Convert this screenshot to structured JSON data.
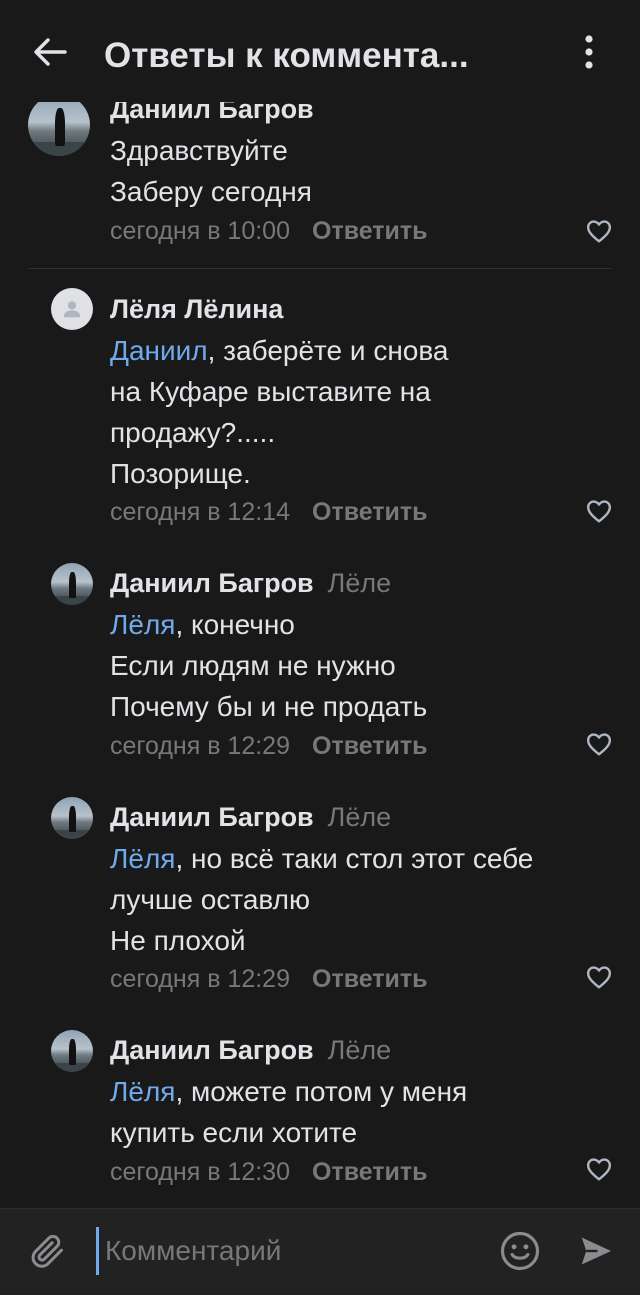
{
  "header": {
    "title": "Ответы к коммента...",
    "back_icon": "arrow-left-icon",
    "menu_icon": "more-vertical-icon"
  },
  "comments": [
    {
      "author": "Даниил Багров",
      "reply_to": "",
      "avatar": "photo",
      "lines": [
        "Здравствуйте",
        "Заберу сегодня"
      ],
      "mention": "",
      "time": "сегодня в 10:00",
      "reply_label": "Ответить"
    },
    {
      "author": "Лёля Лёлина",
      "reply_to": "",
      "avatar": "placeholder",
      "mention": "Даниил",
      "lines": [
        ", заберёте и снова",
        "на Куфаре выставите на",
        "продажу?.....",
        "Позорище."
      ],
      "time": "сегодня в 12:14",
      "reply_label": "Ответить"
    },
    {
      "author": "Даниил Багров",
      "reply_to": "Лёле",
      "avatar": "photo",
      "mention": "Лёля",
      "lines": [
        ", конечно",
        "Если людям не нужно",
        "Почему бы и не продать"
      ],
      "time": "сегодня в 12:29",
      "reply_label": "Ответить"
    },
    {
      "author": "Даниил Багров",
      "reply_to": "Лёле",
      "avatar": "photo",
      "mention": "Лёля",
      "lines": [
        ", но всё таки стол этот себе",
        "лучше оставлю",
        "Не плохой"
      ],
      "time": "сегодня в 12:29",
      "reply_label": "Ответить"
    },
    {
      "author": "Даниил Багров",
      "reply_to": "Лёле",
      "avatar": "photo",
      "mention": "Лёля",
      "lines": [
        ", можете потом у меня",
        "купить если хотите"
      ],
      "time": "сегодня в 12:30",
      "reply_label": "Ответить"
    }
  ],
  "composer": {
    "placeholder": "Комментарий",
    "attach_icon": "paperclip-icon",
    "emoji_icon": "smile-icon",
    "send_icon": "send-icon"
  },
  "colors": {
    "background": "#19191a",
    "text": "#e1e3e6",
    "secondary": "#76787a",
    "accent": "#71aaeb"
  }
}
